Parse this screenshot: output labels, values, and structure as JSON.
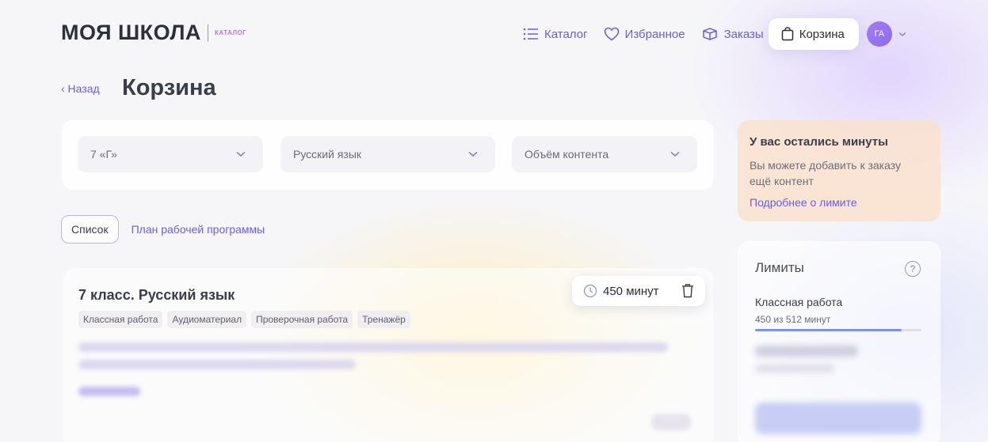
{
  "header": {
    "logo_main": "МОЯ ШКОЛА",
    "logo_sub": "КАТАЛОГ",
    "nav": {
      "catalog": "Каталог",
      "favorites": "Избранное",
      "orders": "Заказы",
      "cart": "Корзина"
    },
    "avatar": "ГА"
  },
  "page": {
    "back": "‹ Назад",
    "title": "Корзина"
  },
  "filters": {
    "class": "7 «Г»",
    "subject": "Русский язык",
    "volume": "Объём контента"
  },
  "view": {
    "list": "Список",
    "plan": "План рабочей программы"
  },
  "card": {
    "title": "7 класс. Русский язык",
    "tags": [
      "Классная работа",
      "Аудиоматериал",
      "Проверочная работа",
      "Тренажёр"
    ],
    "minutes": "450 минут"
  },
  "notice": {
    "title": "У вас остались минуты",
    "text": "Вы можете добавить к заказу ещё контент",
    "link": "Подробнее о лимите"
  },
  "limits": {
    "title": "Лимиты",
    "help": "?",
    "class_work_label": "Классная работа",
    "class_work_value": "450 из 512 минут",
    "class_work_used": 450,
    "class_work_total": 512
  },
  "colors": {
    "accent": "#6b5fd6",
    "progress": "#7f94de",
    "notice_bg": "#fae2ce"
  }
}
